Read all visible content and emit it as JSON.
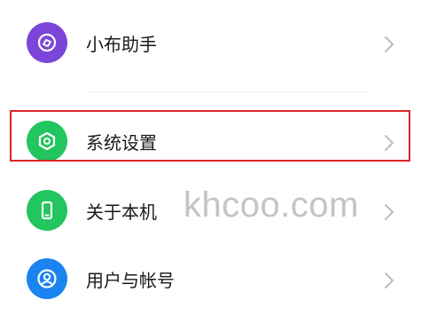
{
  "colors": {
    "assistant_icon_bg": "#7b45d9",
    "settings_icon_bg": "#22c55e",
    "about_icon_bg": "#22c55e",
    "account_icon_bg": "#1a84f0",
    "highlight_border": "#d8252a"
  },
  "icons": {
    "assistant": "sparkle-icon",
    "settings": "gear-hexagon-icon",
    "about": "phone-icon",
    "account": "user-icon",
    "chevron": "chevron-right-icon"
  },
  "menu": {
    "items": [
      {
        "label": "小布助手"
      },
      {
        "label": "系统设置"
      },
      {
        "label": "关于本机"
      },
      {
        "label": "用户与帐号"
      }
    ]
  },
  "watermark": "khcoo.com"
}
